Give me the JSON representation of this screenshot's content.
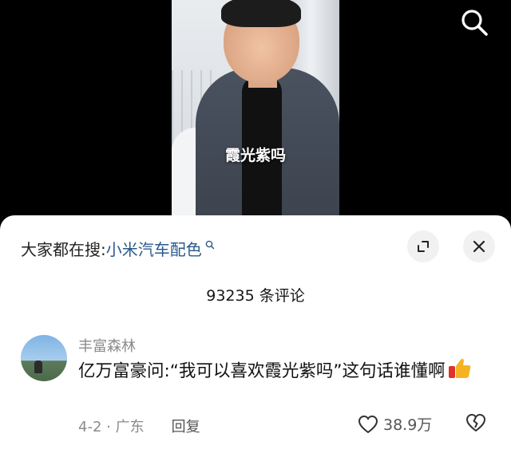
{
  "video": {
    "caption": "霞光紫吗"
  },
  "header": {
    "search_icon": "search-icon"
  },
  "sheet": {
    "suggest_prefix": "大家都在搜:",
    "suggest_keyword": "小米汽车配色",
    "expand_icon": "expand-icon",
    "close_icon": "close-icon",
    "comment_count": "93235 条评论"
  },
  "comment": {
    "username": "丰富森林",
    "text": "亿万富豪问:“我可以喜欢霞光紫吗”这句话谁懂啊",
    "emoji": "thumbs-up",
    "meta": "4-2 · 广东",
    "reply_label": "回复",
    "like_count": "38.9万"
  },
  "colors": {
    "keyword": "#2b5a8c",
    "muted": "#8a8a8a",
    "background": "#000000"
  }
}
